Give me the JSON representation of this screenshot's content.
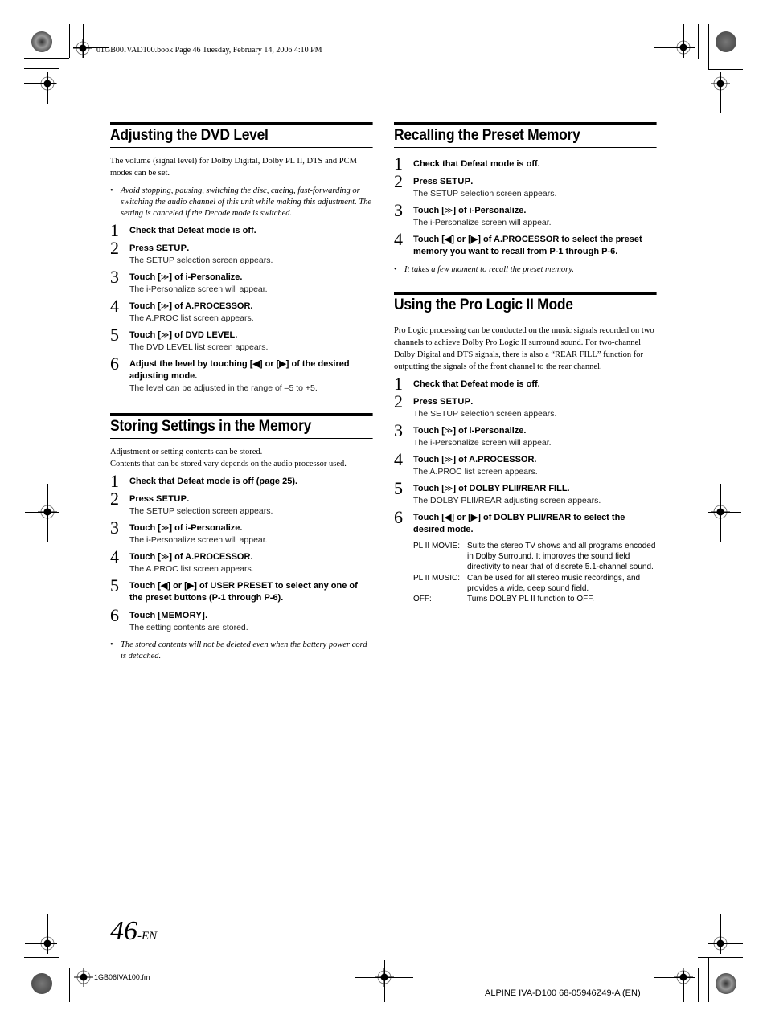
{
  "header": {
    "file_info": "01GB00IVAD100.book  Page 46  Tuesday, February 14, 2006  4:10 PM"
  },
  "left_column": {
    "dvd_level": {
      "title": "Adjusting the DVD Level",
      "intro": "The volume (signal level) for Dolby Digital, Dolby PL II, DTS and PCM modes can be set.",
      "note": "Avoid stopping, pausing, switching the disc, cueing, fast-forwarding or switching the audio channel of this unit while making this adjustment. The setting is canceled if the Decode mode is switched.",
      "steps": [
        {
          "num": "1",
          "pre": "Check that Defeat mode is off.",
          "key": "",
          "post": "",
          "result": ""
        },
        {
          "num": "2",
          "pre": "Press ",
          "key": "SETUP",
          "post": ".",
          "result": "The SETUP selection screen appears."
        },
        {
          "num": "3",
          "pre": "Touch [",
          "key": "≫",
          "post": "] of i-Personalize.",
          "result": "The i-Personalize screen will appear."
        },
        {
          "num": "4",
          "pre": "Touch [",
          "key": "≫",
          "post": "] of A.PROCESSOR.",
          "result": "The A.PROC list screen appears."
        },
        {
          "num": "5",
          "pre": "Touch [",
          "key": "≫",
          "post": "] of DVD LEVEL.",
          "result": "The DVD LEVEL list screen appears."
        },
        {
          "num": "6",
          "pre": "Adjust the level by touching [◀] or [▶] of the desired adjusting mode.",
          "key": "",
          "post": "",
          "result": "The level can be adjusted in the range of –5 to +5."
        }
      ]
    },
    "storing": {
      "title": "Storing Settings in the Memory",
      "intro_lines": [
        "Adjustment or setting contents can be stored.",
        "Contents that can be stored vary depends on the audio processor used."
      ],
      "steps": [
        {
          "num": "1",
          "pre": "Check that Defeat mode is off (page 25).",
          "key": "",
          "post": "",
          "result": ""
        },
        {
          "num": "2",
          "pre": "Press ",
          "key": "SETUP",
          "post": ".",
          "result": "The SETUP selection screen appears."
        },
        {
          "num": "3",
          "pre": "Touch [",
          "key": "≫",
          "post": "] of i-Personalize.",
          "result": "The i-Personalize screen will appear."
        },
        {
          "num": "4",
          "pre": "Touch [",
          "key": "≫",
          "post": "] of A.PROCESSOR.",
          "result": "The A.PROC list screen appears."
        },
        {
          "num": "5",
          "pre": "Touch [◀] or [▶] of USER PRESET to select any one of the preset buttons (P-1 through P-6).",
          "key": "",
          "post": "",
          "result": ""
        },
        {
          "num": "6",
          "pre": "Touch ",
          "key": "[MEMORY]",
          "post": ".",
          "result": "The setting contents are stored."
        }
      ],
      "note": "The stored contents will not be deleted even when the battery power cord is detached."
    }
  },
  "right_column": {
    "recalling": {
      "title": "Recalling the Preset Memory",
      "steps": [
        {
          "num": "1",
          "pre": "Check that Defeat mode is off.",
          "key": "",
          "post": "",
          "result": ""
        },
        {
          "num": "2",
          "pre": "Press ",
          "key": "SETUP",
          "post": ".",
          "result": "The SETUP selection screen appears."
        },
        {
          "num": "3",
          "pre": "Touch [",
          "key": "≫",
          "post": "] of i-Personalize.",
          "result": "The i-Personalize screen will appear."
        },
        {
          "num": "4",
          "pre": "Touch [◀] or [▶] of A.PROCESSOR to select the preset memory you want to recall from P-1 through P-6.",
          "key": "",
          "post": "",
          "result": ""
        }
      ],
      "note": "It takes a few moment to recall the preset memory."
    },
    "pro_logic": {
      "title": "Using the Pro Logic II Mode",
      "intro": "Pro Logic processing can be conducted on the music signals recorded on two channels to achieve Dolby Pro Logic II surround sound.  For two-channel Dolby Digital and DTS signals, there is also a “REAR FILL” function for outputting the signals of the front channel to the rear channel.",
      "steps": [
        {
          "num": "1",
          "pre": "Check that Defeat mode is off.",
          "key": "",
          "post": "",
          "result": ""
        },
        {
          "num": "2",
          "pre": "Press ",
          "key": "SETUP",
          "post": ".",
          "result": "The SETUP selection screen appears."
        },
        {
          "num": "3",
          "pre": "Touch [",
          "key": "≫",
          "post": "] of i-Personalize.",
          "result": "The i-Personalize screen will appear."
        },
        {
          "num": "4",
          "pre": "Touch [",
          "key": "≫",
          "post": "] of A.PROCESSOR.",
          "result": "The A.PROC list screen appears."
        },
        {
          "num": "5",
          "pre": "Touch [",
          "key": "≫",
          "post": "] of DOLBY PLII/REAR FILL.",
          "result": "The DOLBY PLII/REAR adjusting screen appears."
        },
        {
          "num": "6",
          "pre": "Touch [◀] or [▶] of DOLBY PLII/REAR to select the desired mode.",
          "key": "",
          "post": "",
          "result": ""
        }
      ],
      "modes": [
        {
          "term": "PL II MOVIE:",
          "desc": "Suits the stereo TV shows and all programs encoded in Dolby Surround.  It improves the sound field directivity to near that of discrete 5.1-channel sound."
        },
        {
          "term": "PL II MUSIC:",
          "desc": "Can be used for all stereo music recordings, and provides a wide, deep sound field."
        },
        {
          "term": "OFF:",
          "desc": "Turns DOLBY PL II function to OFF."
        }
      ]
    }
  },
  "footer": {
    "page_number": "46",
    "page_suffix": "-EN",
    "file_name": "1GB06IVA100.fm",
    "model_code": "ALPINE IVA-D100 68-05946Z49-A (EN)"
  }
}
